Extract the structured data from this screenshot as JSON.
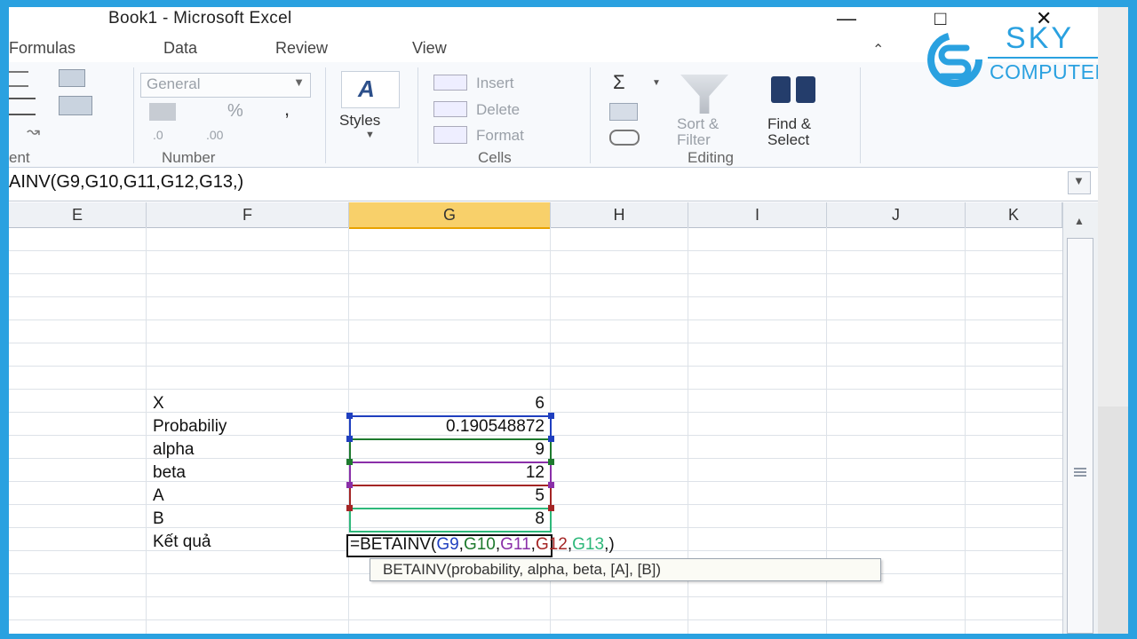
{
  "window": {
    "title": "Book1  -  Microsoft Excel",
    "buttons": {
      "minimize": "—",
      "maximize": "□",
      "close": "✕"
    }
  },
  "ribbon_tabs": [
    "Formulas",
    "Data",
    "Review",
    "View"
  ],
  "ribbon": {
    "alignment_label": "ent",
    "number": {
      "format_value": "General",
      "percent": "%",
      "comma": ",",
      "inc_decimal": ".00",
      "dec_decimal": ".0",
      "label": "Number"
    },
    "styles": {
      "label": "Styles"
    },
    "cells": {
      "insert": "Insert",
      "delete": "Delete",
      "format": "Format",
      "label": "Cells"
    },
    "editing": {
      "sum": "Σ",
      "sort_line1": "Sort &",
      "sort_line2": "Filter",
      "find_line1": "Find &",
      "find_line2": "Select",
      "label": "Editing"
    }
  },
  "formula_bar": {
    "text": "AINV(G9,G10,G11,G12,G13,)"
  },
  "columns": [
    "E",
    "F",
    "G",
    "H",
    "I",
    "J",
    "K"
  ],
  "rows": [
    {
      "label": "X",
      "value": "6"
    },
    {
      "label": "Probabiliy",
      "value": "0.190548872"
    },
    {
      "label": "alpha",
      "value": "9"
    },
    {
      "label": "beta",
      "value": "12"
    },
    {
      "label": "A",
      "value": "5"
    },
    {
      "label": "B",
      "value": "8"
    },
    {
      "label": "Kết quả",
      "value": ""
    }
  ],
  "edit_formula": {
    "prefix": "=BETAINV(",
    "args": [
      {
        "text": "G9",
        "color": "#1f3fbf"
      },
      {
        "text": "G10",
        "color": "#1e7a2e"
      },
      {
        "text": "G11",
        "color": "#8a2fa8"
      },
      {
        "text": "G12",
        "color": "#a42525"
      },
      {
        "text": "G13",
        "color": "#2eb87a"
      }
    ],
    "suffix": ")"
  },
  "tooltip": "BETAINV(probability, alpha, beta, [A], [B])",
  "logo": {
    "line1": "SKY",
    "line2": "COMPUTER",
    "color": "#2aa1e0"
  },
  "colors": {
    "active_col": "#f8d06a",
    "window_border": "#2aa1e0"
  }
}
